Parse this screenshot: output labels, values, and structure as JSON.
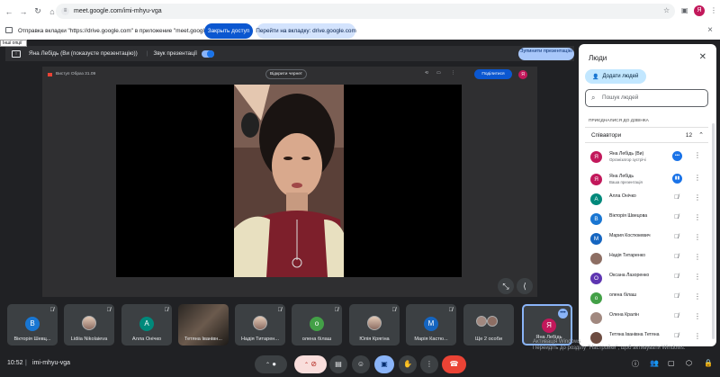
{
  "browser": {
    "url": "meet.google.com/imi-mhyu-vga",
    "profile_initial": "Я"
  },
  "infobar": {
    "message": "Отправка вкладки \"https://drive.google.com\" в приложение \"meet.google.com\"...",
    "allow_button": "Закрыть доступ",
    "switch_button": "Перейти на вкладку: drive.google.com"
  },
  "tooltip": "Інші опції",
  "presenter_bar": {
    "presenter": "Яна Лебідь (Ви (показуєте презентацію))",
    "sound_label": "Звук презентації",
    "sound_on": true,
    "stop_button": "Зупинити презентацію"
  },
  "slide": {
    "left_label": "Виступ Образ 31.09",
    "center_button": "Відкрити чернет",
    "share_button": "Поділитися",
    "profile_initial": "Я"
  },
  "tiles": [
    {
      "name": "Вікторія Шевц...",
      "initial": "В",
      "color": "#1976d2",
      "kind": "avatar",
      "muted": true
    },
    {
      "name": "Lidiia Nikolaieva",
      "initial": "",
      "color": "",
      "kind": "photo",
      "muted": true
    },
    {
      "name": "Алла Онічко",
      "initial": "А",
      "color": "#00897b",
      "kind": "avatar",
      "muted": true
    },
    {
      "name": "Тетяна Іванівн...",
      "initial": "",
      "color": "",
      "kind": "video",
      "muted": false
    },
    {
      "name": "Надія Титарен...",
      "initial": "",
      "color": "",
      "kind": "photo",
      "muted": true
    },
    {
      "name": "олена білаш",
      "initial": "о",
      "color": "#43a047",
      "kind": "avatar",
      "muted": true
    },
    {
      "name": "Юлія Крягіна",
      "initial": "",
      "color": "",
      "kind": "photo",
      "muted": true
    },
    {
      "name": "Марія Кастю...",
      "initial": "М",
      "color": "#1565c0",
      "kind": "avatar",
      "muted": true
    },
    {
      "name": "Ще 2 особи",
      "initial": "",
      "color": "",
      "kind": "group",
      "muted": false
    },
    {
      "name": "Яна Лебідь",
      "initial": "Я",
      "color": "#c2185b",
      "kind": "avatar",
      "muted": false
    }
  ],
  "bottom": {
    "time": "10:52",
    "meeting_code": "imi-mhyu-vga"
  },
  "people_panel": {
    "title": "Люди",
    "add_people": "Додати людей",
    "search_placeholder": "Пошук людей",
    "joined_label": "ПРИЄДНАЛИСЯ ДО ДЗВІНКА",
    "group_label": "Співавтори",
    "group_count": "12",
    "people": [
      {
        "name": "Яна Лебідь (Ви)",
        "sub": "Організатор зустрічі",
        "initial": "Я",
        "color": "#c2185b",
        "state": "more"
      },
      {
        "name": "Яна Лебідь",
        "sub": "Ваша презентація",
        "initial": "Я",
        "color": "#c2185b",
        "state": "sound"
      },
      {
        "name": "Алла Онічко",
        "sub": "",
        "initial": "А",
        "color": "#00897b",
        "state": "muted"
      },
      {
        "name": "Вікторія Швецова",
        "sub": "",
        "initial": "В",
        "color": "#1976d2",
        "state": "muted"
      },
      {
        "name": "Мария Костюкевич",
        "sub": "",
        "initial": "М",
        "color": "#1565c0",
        "state": "muted"
      },
      {
        "name": "Надія Титаренко",
        "sub": "",
        "initial": "",
        "color": "#8d6e63",
        "state": "muted"
      },
      {
        "name": "Оксана Лазоренко",
        "sub": "",
        "initial": "О",
        "color": "#5e35b1",
        "state": "muted"
      },
      {
        "name": "олена білаш",
        "sub": "",
        "initial": "о",
        "color": "#43a047",
        "state": "muted"
      },
      {
        "name": "Олена Кралін",
        "sub": "",
        "initial": "",
        "color": "#a1887f",
        "state": "muted"
      },
      {
        "name": "Тетяна Іванівна Тетяна",
        "sub": "",
        "initial": "",
        "color": "#6d4c41",
        "state": "muted"
      }
    ]
  },
  "watermark": {
    "line1": "Активація Windows",
    "line2": "Перейдіть до розділу \"Настройки\", щоб активувати Windows."
  }
}
